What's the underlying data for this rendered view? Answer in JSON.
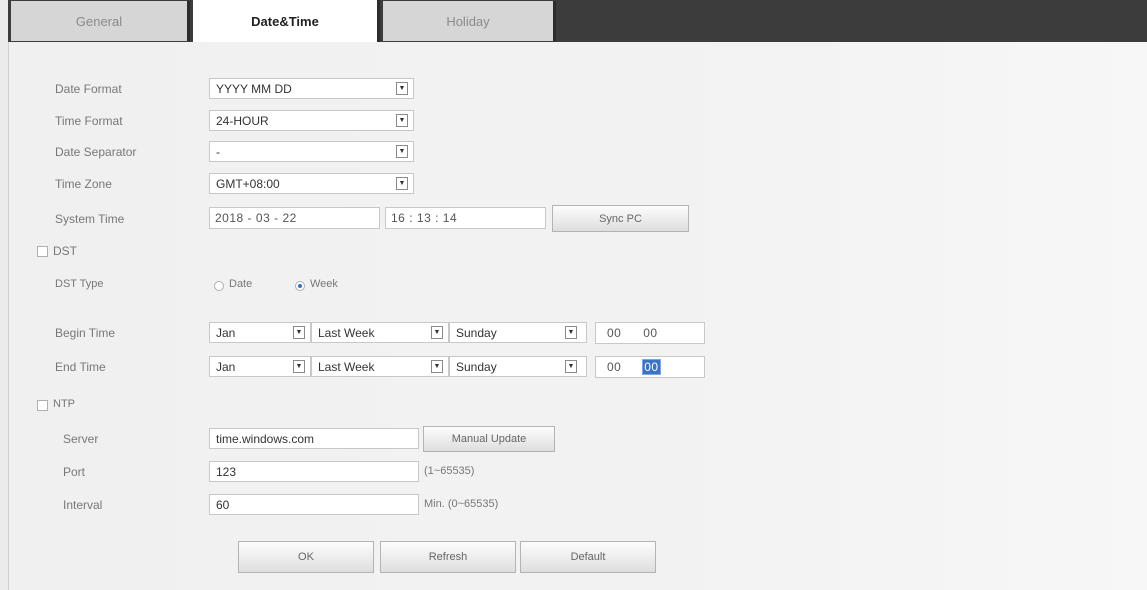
{
  "tabs": [
    {
      "label": "General",
      "active": false
    },
    {
      "label": "Date&Time",
      "active": true
    },
    {
      "label": "Holiday",
      "active": false
    }
  ],
  "date_format": {
    "label": "Date Format",
    "value": "YYYY MM DD"
  },
  "time_format": {
    "label": "Time Format",
    "value": "24-HOUR"
  },
  "date_separator": {
    "label": "Date Separator",
    "value": "-"
  },
  "time_zone": {
    "label": "Time Zone",
    "value": "GMT+08:00"
  },
  "system_time": {
    "label": "System Time",
    "year": "2018",
    "month": "03",
    "day": "22",
    "hour": "16",
    "minute": "13",
    "second": "14",
    "date_sep": "-",
    "time_sep": ":",
    "sync_label": "Sync PC"
  },
  "dst": {
    "label": "DST",
    "checked": false,
    "type_label": "DST Type",
    "type_options": [
      {
        "label": "Date",
        "selected": false
      },
      {
        "label": "Week",
        "selected": true
      }
    ],
    "begin": {
      "label": "Begin Time",
      "month": "Jan",
      "week": "Last Week",
      "day": "Sunday",
      "hour": "00",
      "minute": "00"
    },
    "end": {
      "label": "End Time",
      "month": "Jan",
      "week": "Last Week",
      "day": "Sunday",
      "hour": "00",
      "minute": "00"
    }
  },
  "ntp": {
    "label": "NTP",
    "checked": false,
    "server_label": "Server",
    "server_value": "time.windows.com",
    "manual_update_label": "Manual Update",
    "port_label": "Port",
    "port_value": "123",
    "port_hint": "(1~65535)",
    "interval_label": "Interval",
    "interval_value": "60",
    "interval_hint": "Min. (0~65535)"
  },
  "buttons": {
    "ok": "OK",
    "refresh": "Refresh",
    "default": "Default"
  },
  "colors": {
    "tabbar": "#3c3c3c",
    "active_tab": "#ffffff",
    "inactive_tab": "#d6d6d6",
    "panel": "#f0f0f0",
    "selection": "#3b73c9"
  },
  "icons": {
    "dropdown": "triangle-down",
    "checkbox": "square",
    "radio": "circle"
  }
}
